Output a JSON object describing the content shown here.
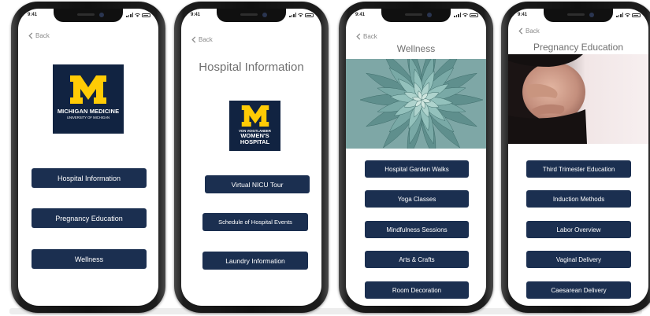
{
  "status": {
    "time": "9:41"
  },
  "common": {
    "back_label": "Back"
  },
  "colors": {
    "button": "#1b2f50",
    "logo_navy": "#112341",
    "maize": "#ffcb05",
    "title_grey": "#6f6f6f"
  },
  "screens": {
    "home": {
      "logo": {
        "line1": "MICHIGAN MEDICINE",
        "line2": "UNIVERSITY OF MICHIGAN"
      },
      "buttons": [
        "Hospital Information",
        "Pregnancy Education",
        "Wellness"
      ]
    },
    "hospital_info": {
      "title": "Hospital Information",
      "logo": {
        "line1": "VON VOIGTLANDER",
        "line2": "WOMEN'S",
        "line3": "HOSPITAL"
      },
      "buttons": [
        "Virtual NICU Tour",
        "Schedule of Hospital Events",
        "Laundry Information"
      ]
    },
    "wellness": {
      "title": "Wellness",
      "buttons": [
        "Hospital Garden Walks",
        "Yoga Classes",
        "Mindfulness Sessions",
        "Arts & Crafts",
        "Room Decoration"
      ]
    },
    "pregnancy": {
      "title": "Pregnancy Education",
      "buttons": [
        "Third Trimester Education",
        "Induction Methods",
        "Labor Overview",
        "Vaginal Delivery",
        "Caesarean Delivery"
      ]
    }
  }
}
